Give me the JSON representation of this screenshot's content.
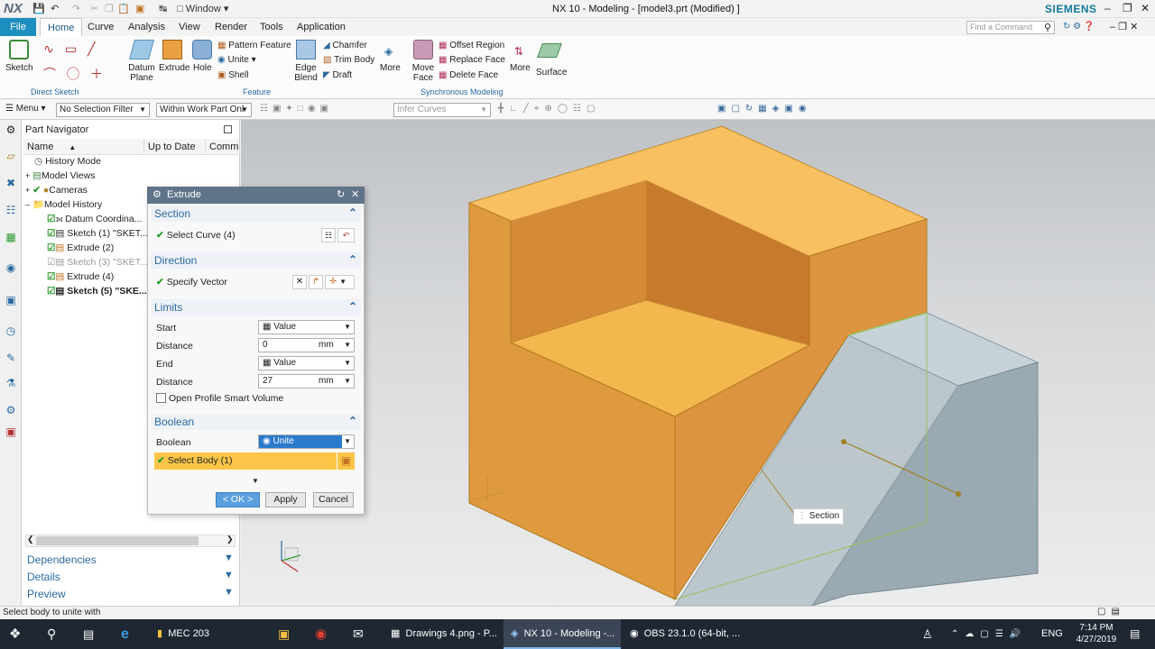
{
  "titlebar": {
    "logo": "NX",
    "window_menu": "Window",
    "title": "NX 10 - Modeling - [model3.prt (Modified) ]",
    "brand": "SIEMENS"
  },
  "menu": {
    "file": "File",
    "tabs": [
      "Home",
      "Curve",
      "Analysis",
      "View",
      "Render",
      "Tools",
      "Application"
    ],
    "find_placeholder": "Find a Command"
  },
  "ribbon": {
    "sketch": "Sketch",
    "direct_sketch": "Direct Sketch",
    "datum_plane": "Datum Plane",
    "extrude": "Extrude",
    "hole": "Hole",
    "pattern_feature": "Pattern Feature",
    "unite": "Unite",
    "shell": "Shell",
    "edge_blend": "Edge Blend",
    "chamfer": "Chamfer",
    "trim_body": "Trim Body",
    "draft": "Draft",
    "more": "More",
    "feature": "Feature",
    "move_face": "Move Face",
    "offset_region": "Offset Region",
    "replace_face": "Replace Face",
    "delete_face": "Delete Face",
    "more2": "More",
    "synchronous_modeling": "Synchronous Modeling",
    "surface": "Surface"
  },
  "toolbar": {
    "menu": "Menu",
    "filter": "No Selection Filter",
    "scope": "Within Work Part Onl",
    "infer": "Infer Curves"
  },
  "navigator": {
    "title": "Part Navigator",
    "col_name": "Name",
    "col_uptodate": "Up to Date",
    "col_comment": "Comm",
    "rows": [
      "History Mode",
      "Model Views",
      "Cameras",
      "Model History",
      "Datum Coordina...",
      "Sketch (1) \"SKET...",
      "Extrude (2)",
      "Sketch (3) \"SKET...",
      "Extrude (4)",
      "Sketch (5) \"SKE..."
    ],
    "dependencies": "Dependencies",
    "details": "Details",
    "preview": "Preview"
  },
  "dialog": {
    "title": "Extrude",
    "section": "Section",
    "select_curve": "Select Curve (4)",
    "direction": "Direction",
    "specify_vector": "Specify Vector",
    "limits": "Limits",
    "start_label": "Start",
    "start_value": "Value",
    "distance1_label": "Distance",
    "distance1_value": "0",
    "unit1": "mm",
    "end_label": "End",
    "end_value": "Value",
    "distance2_label": "Distance",
    "distance2_value": "27",
    "unit2": "mm",
    "open_profile": "Open Profile Smart Volume",
    "boolean_section": "Boolean",
    "boolean_label": "Boolean",
    "boolean_value": "Unite",
    "select_body": "Select Body (1)",
    "ok": "< OK >",
    "apply": "Apply",
    "cancel": "Cancel"
  },
  "viewport": {
    "section_tag": "Section"
  },
  "status": {
    "message": "Select body to unite with"
  },
  "taskbar": {
    "mec": "MEC 203",
    "drawings": "Drawings 4.png - P...",
    "nx": "NX 10 - Modeling -...",
    "obs": "OBS 23.1.0 (64-bit, ...",
    "lang": "ENG",
    "time": "7:14 PM",
    "date": "4/27/2019"
  },
  "colors": {
    "accent": "#1c8fbf",
    "body": "#f4b04a",
    "preview": "#9fb6c2"
  }
}
